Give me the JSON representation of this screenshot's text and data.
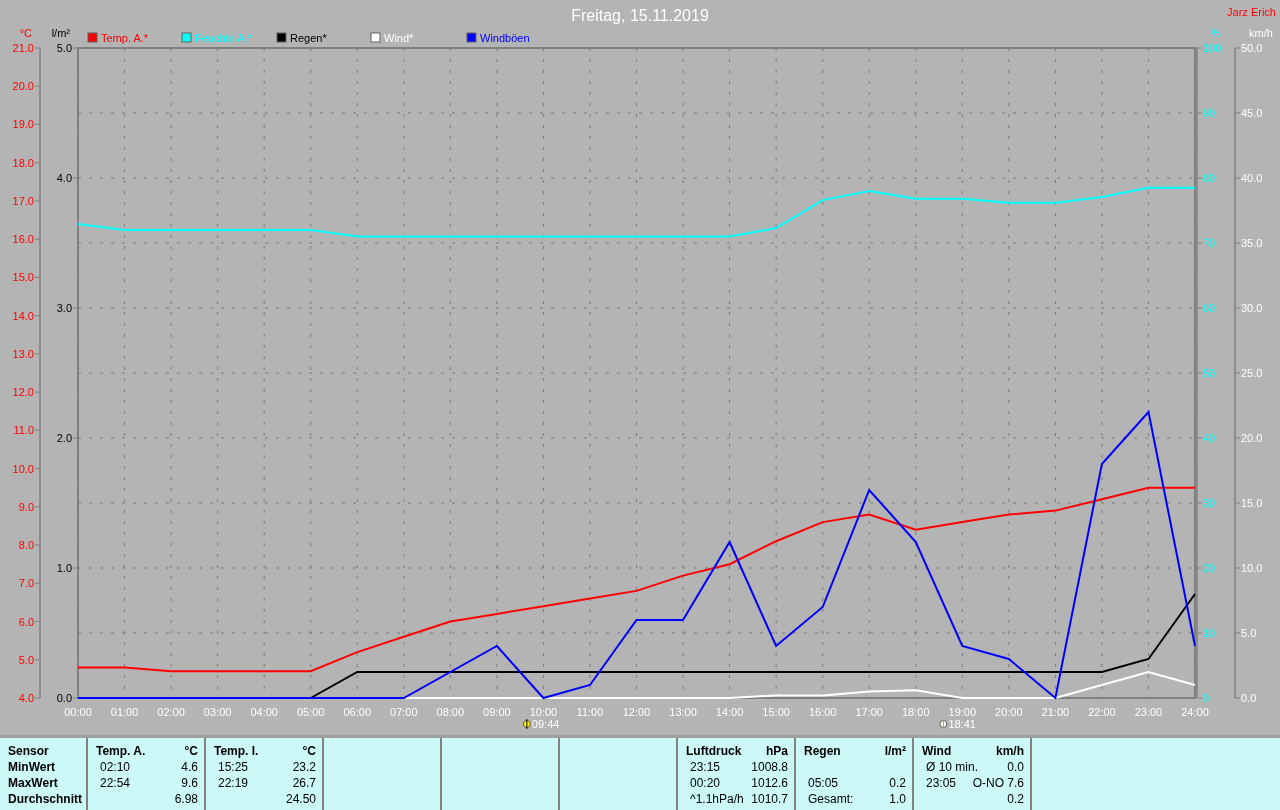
{
  "author": "Jarz Erich",
  "charts": [
    {
      "chart_data": {
        "type": "line",
        "title": "Freitag, 15.11.2019",
        "x": [
          0,
          1,
          2,
          3,
          4,
          5,
          6,
          7,
          8,
          9,
          10,
          11,
          12,
          13,
          14,
          15,
          16,
          17,
          18,
          19,
          20,
          21,
          22,
          23,
          24
        ],
        "xlim": [
          0,
          24
        ],
        "xticks": [
          {
            "value": 0,
            "label": "00:00"
          },
          {
            "value": 1,
            "label": "01:00"
          },
          {
            "value": 2,
            "label": "02:00"
          },
          {
            "value": 3,
            "label": "03:00"
          },
          {
            "value": 4,
            "label": "04:00"
          },
          {
            "value": 5,
            "label": "05:00"
          },
          {
            "value": 6,
            "label": "06:00"
          },
          {
            "value": 7,
            "label": "07:00"
          },
          {
            "value": 8,
            "label": "08:00"
          },
          {
            "value": 9,
            "label": "09:00"
          },
          {
            "value": 10,
            "label": "10:00"
          },
          {
            "value": 11,
            "label": "11:00"
          },
          {
            "value": 12,
            "label": "12:00"
          },
          {
            "value": 13,
            "label": "13:00"
          },
          {
            "value": 14,
            "label": "14:00"
          },
          {
            "value": 15,
            "label": "15:00"
          },
          {
            "value": 16,
            "label": "16:00"
          },
          {
            "value": 17,
            "label": "17:00"
          },
          {
            "value": 18,
            "label": "18:00"
          },
          {
            "value": 19,
            "label": "19:00"
          },
          {
            "value": 20,
            "label": "20:00"
          },
          {
            "value": 21,
            "label": "21:00"
          },
          {
            "value": 22,
            "label": "22:00"
          },
          {
            "value": 23,
            "label": "23:00"
          },
          {
            "value": 24,
            "label": "24:00"
          }
        ],
        "ylabel": "°C",
        "ylim": [
          4,
          21
        ],
        "yticks": [
          {
            "value": 4,
            "label": "4.0"
          },
          {
            "value": 5,
            "label": "5.0"
          },
          {
            "value": 6,
            "label": "6.0"
          },
          {
            "value": 7,
            "label": "7.0"
          },
          {
            "value": 8,
            "label": "8.0"
          },
          {
            "value": 9,
            "label": "9.0"
          },
          {
            "value": 10,
            "label": "10.0"
          },
          {
            "value": 11,
            "label": "11.0"
          },
          {
            "value": 12,
            "label": "12.0"
          },
          {
            "value": 13,
            "label": "13.0"
          },
          {
            "value": 14,
            "label": "14.0"
          },
          {
            "value": 15,
            "label": "15.0"
          },
          {
            "value": 16,
            "label": "16.0"
          },
          {
            "value": 17,
            "label": "17.0"
          },
          {
            "value": 18,
            "label": "18.0"
          },
          {
            "value": 19,
            "label": "19.0"
          },
          {
            "value": 20,
            "label": "20.0"
          },
          {
            "value": 21,
            "label": "21.0"
          }
        ],
        "y2label": "l/m²",
        "y2lim": [
          0,
          5
        ],
        "y2ticks": [
          {
            "value": 0,
            "label": "0.0"
          },
          {
            "value": 1,
            "label": "1.0"
          },
          {
            "value": 2,
            "label": "2.0"
          },
          {
            "value": 3,
            "label": "3.0"
          },
          {
            "value": 4,
            "label": "4.0"
          },
          {
            "value": 5,
            "label": "5.0"
          }
        ],
        "series": [
          {
            "name": "Temp. A.*",
            "color": "#ff0000",
            "values": [
              4.8,
              4.8,
              4.7,
              4.7,
              4.7,
              4.7,
              5.2,
              5.6,
              6.0,
              6.2,
              6.4,
              6.6,
              6.8,
              7.2,
              7.5,
              8.1,
              8.6,
              8.8,
              8.4,
              8.6,
              8.8,
              8.9,
              9.2,
              9.5,
              9.5
            ]
          },
          {
            "name": "Regen*",
            "color": "#000000",
            "axis": "y2",
            "values": [
              null,
              null,
              null,
              null,
              null,
              0,
              0.2,
              0.2,
              0.2,
              0.2,
              0.2,
              0.2,
              0.2,
              0.2,
              0.2,
              0.2,
              0.2,
              0.2,
              0.2,
              0.2,
              0.2,
              0.2,
              0.2,
              0.3,
              0.8
            ]
          }
        ],
        "grid": true,
        "annotations": [
          "09:44",
          "18:41"
        ]
      }
    },
    {
      "chart_data": {
        "type": "line",
        "x": [
          0,
          1,
          2,
          3,
          4,
          5,
          6,
          7,
          8,
          9,
          10,
          11,
          12,
          13,
          14,
          15,
          16,
          17,
          18,
          19,
          20,
          21,
          22,
          23,
          24
        ],
        "xlim": [
          0,
          24
        ],
        "ylabel": "%",
        "ylim": [
          0,
          100
        ],
        "yticks": [
          {
            "value": 0,
            "label": "0"
          },
          {
            "value": 10,
            "label": "10"
          },
          {
            "value": 20,
            "label": "20"
          },
          {
            "value": 30,
            "label": "30"
          },
          {
            "value": 40,
            "label": "40"
          },
          {
            "value": 50,
            "label": "50"
          },
          {
            "value": 60,
            "label": "60"
          },
          {
            "value": 70,
            "label": "70"
          },
          {
            "value": 80,
            "label": "80"
          },
          {
            "value": 90,
            "label": "90"
          },
          {
            "value": 100,
            "label": "100"
          }
        ],
        "y2label": "km/h",
        "y2lim": [
          0,
          50
        ],
        "y2ticks": [
          {
            "value": 0,
            "label": "0.0"
          },
          {
            "value": 5,
            "label": "5.0"
          },
          {
            "value": 10,
            "label": "10.0"
          },
          {
            "value": 15,
            "label": "15.0"
          },
          {
            "value": 20,
            "label": "20.0"
          },
          {
            "value": 25,
            "label": "25.0"
          },
          {
            "value": 30,
            "label": "30.0"
          },
          {
            "value": 35,
            "label": "35.0"
          },
          {
            "value": 40,
            "label": "40.0"
          },
          {
            "value": 45,
            "label": "45.0"
          },
          {
            "value": 50,
            "label": "50.0"
          }
        ],
        "series": [
          {
            "name": "Feuchte A.*",
            "color": "#00ffff",
            "values": [
              72.9,
              72,
              72,
              72,
              72,
              72,
              71,
              71,
              71,
              71,
              71,
              71,
              71,
              71,
              71,
              72.3,
              76.6,
              78,
              76.8,
              76.8,
              76.2,
              76.2,
              77.1,
              78.5,
              78.5
            ]
          },
          {
            "name": "Wind*",
            "color": "#ffffff",
            "axis": "y2",
            "values": [
              null,
              null,
              null,
              null,
              null,
              null,
              0,
              0,
              0,
              0,
              0,
              0,
              0,
              0,
              0,
              0.2,
              0.2,
              0.5,
              0.6,
              0,
              0,
              0,
              1,
              2,
              1
            ]
          },
          {
            "name": "Windböen",
            "color": "#0000ff",
            "axis": "y2",
            "values": [
              0,
              0,
              0,
              0,
              0,
              0,
              0,
              0,
              2,
              4,
              0,
              1,
              6,
              6,
              12,
              4,
              7,
              16,
              12,
              4,
              3,
              0,
              18,
              22,
              4
            ]
          }
        ]
      }
    }
  ],
  "stats": {
    "row_labels": [
      "Sensor",
      "MinWert",
      "MaxWert",
      "Durchschnitt"
    ],
    "panels": [
      {
        "kind": "sensor",
        "name": "Temp. A.",
        "unit": "°C",
        "rows": [
          {
            "time": "02:10",
            "value": "4.6"
          },
          {
            "time": "22:54",
            "value": "9.6"
          },
          {
            "value": "6.98"
          }
        ]
      },
      {
        "kind": "sensor",
        "name": "Temp. I.",
        "unit": "°C",
        "rows": [
          {
            "time": "15:25",
            "value": "23.2"
          },
          {
            "time": "22:19",
            "value": "26.7"
          },
          {
            "value": "24.50"
          }
        ]
      },
      {
        "kind": "blank"
      },
      {
        "kind": "blank"
      },
      {
        "kind": "blank"
      },
      {
        "kind": "sensor",
        "name": "Luftdruck",
        "unit": "hPa",
        "rows": [
          {
            "time": "23:15",
            "value": "1008.8"
          },
          {
            "time": "00:20",
            "value": "1012.6"
          },
          {
            "time": "^1.1hPa/h",
            "value": "1010.7"
          }
        ]
      },
      {
        "kind": "sensor",
        "name": "Regen",
        "unit": "l/m²",
        "rows": [
          {},
          {
            "time": "05:05",
            "value": "0.2"
          },
          {
            "time": "Gesamt:",
            "value": "1.0"
          }
        ]
      },
      {
        "kind": "sensor",
        "name": "Wind",
        "unit": "km/h",
        "rows": [
          {
            "time": "Ø 10 min.",
            "value": "0.0"
          },
          {
            "time": "23:05",
            "value": "O-NO 7.6"
          },
          {
            "value": "0.2"
          }
        ]
      },
      {
        "kind": "blank"
      }
    ]
  }
}
